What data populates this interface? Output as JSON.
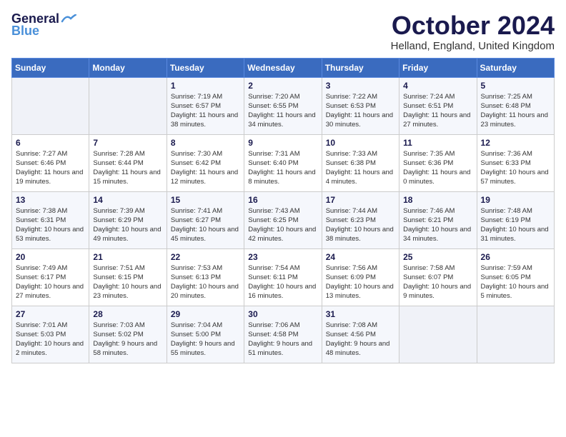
{
  "header": {
    "logo_general": "General",
    "logo_blue": "Blue",
    "month_title": "October 2024",
    "subtitle": "Helland, England, United Kingdom"
  },
  "weekdays": [
    "Sunday",
    "Monday",
    "Tuesday",
    "Wednesday",
    "Thursday",
    "Friday",
    "Saturday"
  ],
  "weeks": [
    [
      {
        "num": "",
        "detail": ""
      },
      {
        "num": "",
        "detail": ""
      },
      {
        "num": "1",
        "detail": "Sunrise: 7:19 AM\nSunset: 6:57 PM\nDaylight: 11 hours and 38 minutes."
      },
      {
        "num": "2",
        "detail": "Sunrise: 7:20 AM\nSunset: 6:55 PM\nDaylight: 11 hours and 34 minutes."
      },
      {
        "num": "3",
        "detail": "Sunrise: 7:22 AM\nSunset: 6:53 PM\nDaylight: 11 hours and 30 minutes."
      },
      {
        "num": "4",
        "detail": "Sunrise: 7:24 AM\nSunset: 6:51 PM\nDaylight: 11 hours and 27 minutes."
      },
      {
        "num": "5",
        "detail": "Sunrise: 7:25 AM\nSunset: 6:48 PM\nDaylight: 11 hours and 23 minutes."
      }
    ],
    [
      {
        "num": "6",
        "detail": "Sunrise: 7:27 AM\nSunset: 6:46 PM\nDaylight: 11 hours and 19 minutes."
      },
      {
        "num": "7",
        "detail": "Sunrise: 7:28 AM\nSunset: 6:44 PM\nDaylight: 11 hours and 15 minutes."
      },
      {
        "num": "8",
        "detail": "Sunrise: 7:30 AM\nSunset: 6:42 PM\nDaylight: 11 hours and 12 minutes."
      },
      {
        "num": "9",
        "detail": "Sunrise: 7:31 AM\nSunset: 6:40 PM\nDaylight: 11 hours and 8 minutes."
      },
      {
        "num": "10",
        "detail": "Sunrise: 7:33 AM\nSunset: 6:38 PM\nDaylight: 11 hours and 4 minutes."
      },
      {
        "num": "11",
        "detail": "Sunrise: 7:35 AM\nSunset: 6:36 PM\nDaylight: 11 hours and 0 minutes."
      },
      {
        "num": "12",
        "detail": "Sunrise: 7:36 AM\nSunset: 6:33 PM\nDaylight: 10 hours and 57 minutes."
      }
    ],
    [
      {
        "num": "13",
        "detail": "Sunrise: 7:38 AM\nSunset: 6:31 PM\nDaylight: 10 hours and 53 minutes."
      },
      {
        "num": "14",
        "detail": "Sunrise: 7:39 AM\nSunset: 6:29 PM\nDaylight: 10 hours and 49 minutes."
      },
      {
        "num": "15",
        "detail": "Sunrise: 7:41 AM\nSunset: 6:27 PM\nDaylight: 10 hours and 45 minutes."
      },
      {
        "num": "16",
        "detail": "Sunrise: 7:43 AM\nSunset: 6:25 PM\nDaylight: 10 hours and 42 minutes."
      },
      {
        "num": "17",
        "detail": "Sunrise: 7:44 AM\nSunset: 6:23 PM\nDaylight: 10 hours and 38 minutes."
      },
      {
        "num": "18",
        "detail": "Sunrise: 7:46 AM\nSunset: 6:21 PM\nDaylight: 10 hours and 34 minutes."
      },
      {
        "num": "19",
        "detail": "Sunrise: 7:48 AM\nSunset: 6:19 PM\nDaylight: 10 hours and 31 minutes."
      }
    ],
    [
      {
        "num": "20",
        "detail": "Sunrise: 7:49 AM\nSunset: 6:17 PM\nDaylight: 10 hours and 27 minutes."
      },
      {
        "num": "21",
        "detail": "Sunrise: 7:51 AM\nSunset: 6:15 PM\nDaylight: 10 hours and 23 minutes."
      },
      {
        "num": "22",
        "detail": "Sunrise: 7:53 AM\nSunset: 6:13 PM\nDaylight: 10 hours and 20 minutes."
      },
      {
        "num": "23",
        "detail": "Sunrise: 7:54 AM\nSunset: 6:11 PM\nDaylight: 10 hours and 16 minutes."
      },
      {
        "num": "24",
        "detail": "Sunrise: 7:56 AM\nSunset: 6:09 PM\nDaylight: 10 hours and 13 minutes."
      },
      {
        "num": "25",
        "detail": "Sunrise: 7:58 AM\nSunset: 6:07 PM\nDaylight: 10 hours and 9 minutes."
      },
      {
        "num": "26",
        "detail": "Sunrise: 7:59 AM\nSunset: 6:05 PM\nDaylight: 10 hours and 5 minutes."
      }
    ],
    [
      {
        "num": "27",
        "detail": "Sunrise: 7:01 AM\nSunset: 5:03 PM\nDaylight: 10 hours and 2 minutes."
      },
      {
        "num": "28",
        "detail": "Sunrise: 7:03 AM\nSunset: 5:02 PM\nDaylight: 9 hours and 58 minutes."
      },
      {
        "num": "29",
        "detail": "Sunrise: 7:04 AM\nSunset: 5:00 PM\nDaylight: 9 hours and 55 minutes."
      },
      {
        "num": "30",
        "detail": "Sunrise: 7:06 AM\nSunset: 4:58 PM\nDaylight: 9 hours and 51 minutes."
      },
      {
        "num": "31",
        "detail": "Sunrise: 7:08 AM\nSunset: 4:56 PM\nDaylight: 9 hours and 48 minutes."
      },
      {
        "num": "",
        "detail": ""
      },
      {
        "num": "",
        "detail": ""
      }
    ]
  ]
}
